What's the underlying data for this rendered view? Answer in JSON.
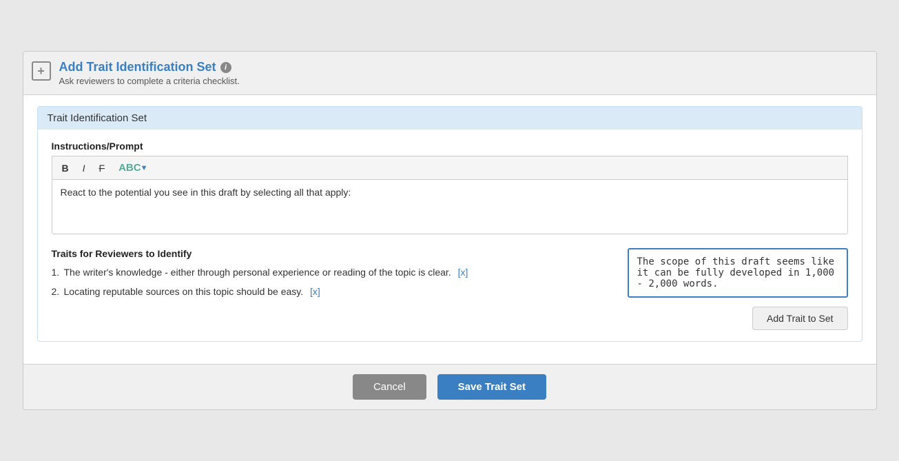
{
  "header": {
    "icon_label": "+",
    "title": "Add Trait Identification Set",
    "info_icon_label": "i",
    "subtitle": "Ask reviewers to complete a criteria checklist."
  },
  "section_card": {
    "title": "Trait Identification Set"
  },
  "instructions": {
    "label": "Instructions/Prompt",
    "toolbar": {
      "bold_label": "B",
      "italic_label": "I",
      "strikethrough_label": "F",
      "spellcheck_label": "ABC"
    },
    "prompt_text": "React to the potential you see in this draft by selecting all that apply:"
  },
  "traits": {
    "section_title": "Traits for Reviewers to Identify",
    "list": [
      {
        "number": "1.",
        "text": "The writer's knowledge - either through personal experience or reading of the topic is clear.",
        "remove_label": "[x]"
      },
      {
        "number": "2.",
        "text": "Locating reputable sources on this topic should be easy.",
        "remove_label": "[x]"
      }
    ],
    "input_value": "The scope of this draft seems like it can be fully developed in 1,000 - 2,000 words.",
    "add_trait_label": "Add Trait to Set"
  },
  "footer": {
    "cancel_label": "Cancel",
    "save_label": "Save Trait Set"
  }
}
